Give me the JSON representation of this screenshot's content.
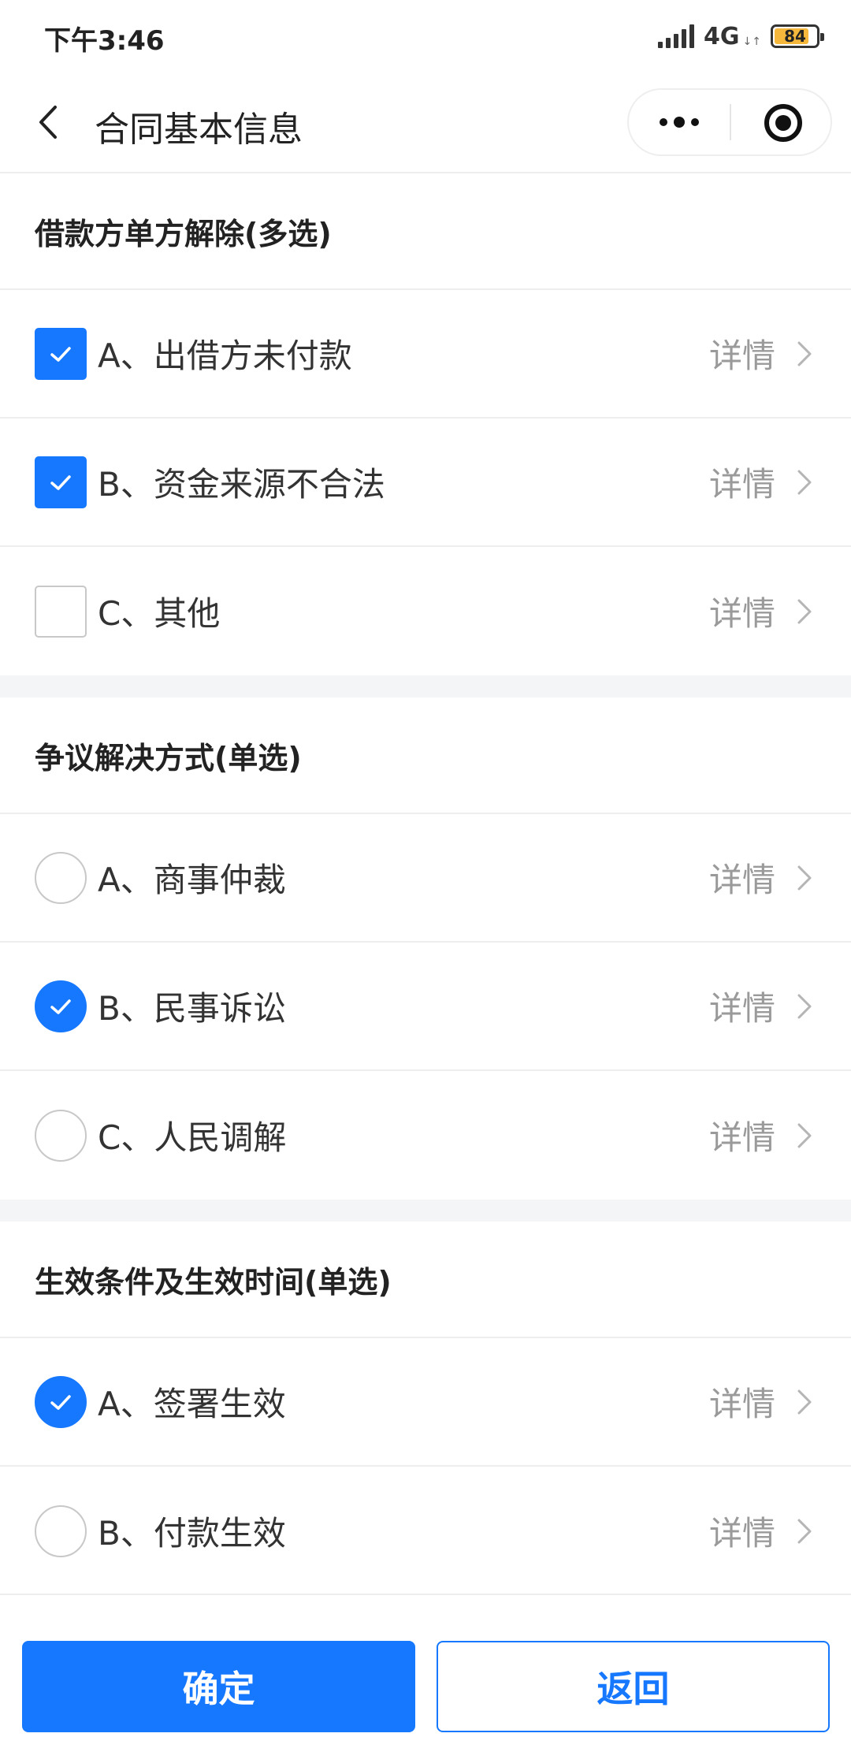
{
  "status_bar": {
    "time": "下午3:46",
    "network": "4G",
    "network_arrows": "↓↑",
    "battery": "84",
    "battery_level": 0.84,
    "battery_color": "#f5b83d"
  },
  "nav": {
    "title": "合同基本信息",
    "back_icon": "chevron-left-icon",
    "more_icon": "more-dots-icon",
    "close_icon": "target-circle-icon"
  },
  "accent_color": "#1677ff",
  "sections": [
    {
      "title": "借款方单方解除(多选)",
      "type": "checkbox",
      "options": [
        {
          "label": "A、出借方未付款",
          "checked": true,
          "detail": "详情"
        },
        {
          "label": "B、资金来源不合法",
          "checked": true,
          "detail": "详情"
        },
        {
          "label": "C、其他",
          "checked": false,
          "detail": "详情"
        }
      ]
    },
    {
      "title": "争议解决方式(单选)",
      "type": "radio",
      "options": [
        {
          "label": "A、商事仲裁",
          "checked": false,
          "detail": "详情"
        },
        {
          "label": "B、民事诉讼",
          "checked": true,
          "detail": "详情"
        },
        {
          "label": "C、人民调解",
          "checked": false,
          "detail": "详情"
        }
      ]
    },
    {
      "title": "生效条件及生效时间(单选)",
      "type": "radio",
      "options": [
        {
          "label": "A、签署生效",
          "checked": true,
          "detail": "详情"
        },
        {
          "label": "B、付款生效",
          "checked": false,
          "detail": "详情"
        }
      ]
    }
  ],
  "buttons": {
    "confirm_label": "确定",
    "back_label": "返回"
  }
}
